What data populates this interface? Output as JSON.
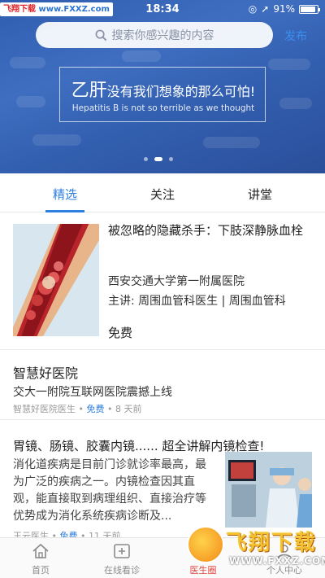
{
  "status_bar": {
    "watermark_tag_red": "飞翔下载",
    "watermark_tag_url": "www.FXXZ.com",
    "time": "18:34",
    "battery": "91%"
  },
  "search": {
    "placeholder": "搜索你感兴趣的内容",
    "publish_label": "发布"
  },
  "banner": {
    "title_big": "乙肝",
    "title_rest": "没有我们想象的那么可怕!",
    "subtitle": "Hepatitis B is not so terrible as we thought",
    "slide_count": 3,
    "active_slide": 2
  },
  "tabs": [
    {
      "label": "精选",
      "active": true
    },
    {
      "label": "关注",
      "active": false
    },
    {
      "label": "讲堂",
      "active": false
    }
  ],
  "feed": {
    "course": {
      "title": "被忽略的隐藏杀手：下肢深静脉血栓",
      "hospital": "西安交通大学第一附属医院",
      "lecturer": "主讲: 周围血管科医生 | 周围血管科",
      "price": "免费"
    },
    "article1": {
      "title": "智慧好医院",
      "subtitle": "交大一附院互联网医院震撼上线",
      "author": "智慧好医院医生",
      "price_tag": "免费",
      "time_ago": "8 天前"
    },
    "article2": {
      "title": "胃镜、肠镜、胶囊内镜...... 超全讲解内镜检查!",
      "body": "消化道疾病是目前门诊就诊率最高，最为广泛的疾病之一。内镜检查因其直观，能直接取到病理组织、直接治疗等优势成为消化系统疾病诊断及...",
      "author": "王云医生",
      "price_tag": "免费",
      "time_ago": "11 天前"
    }
  },
  "bottom_nav": [
    {
      "label": "首页",
      "icon": "home-icon",
      "active": false
    },
    {
      "label": "在线看诊",
      "icon": "add-consult-icon",
      "active": false
    },
    {
      "label": "医生圈",
      "icon": "doctor-circle-icon",
      "active": true
    },
    {
      "label": "个人中心",
      "icon": "person-icon",
      "active": false
    }
  ],
  "watermark": {
    "brand": "飞翔下载",
    "url": "WWW.FXXZ.COM"
  },
  "colors": {
    "accent_blue": "#2f7fe0",
    "banner_blue": "#3a66b8",
    "active_nav_red": "#e2453c"
  }
}
